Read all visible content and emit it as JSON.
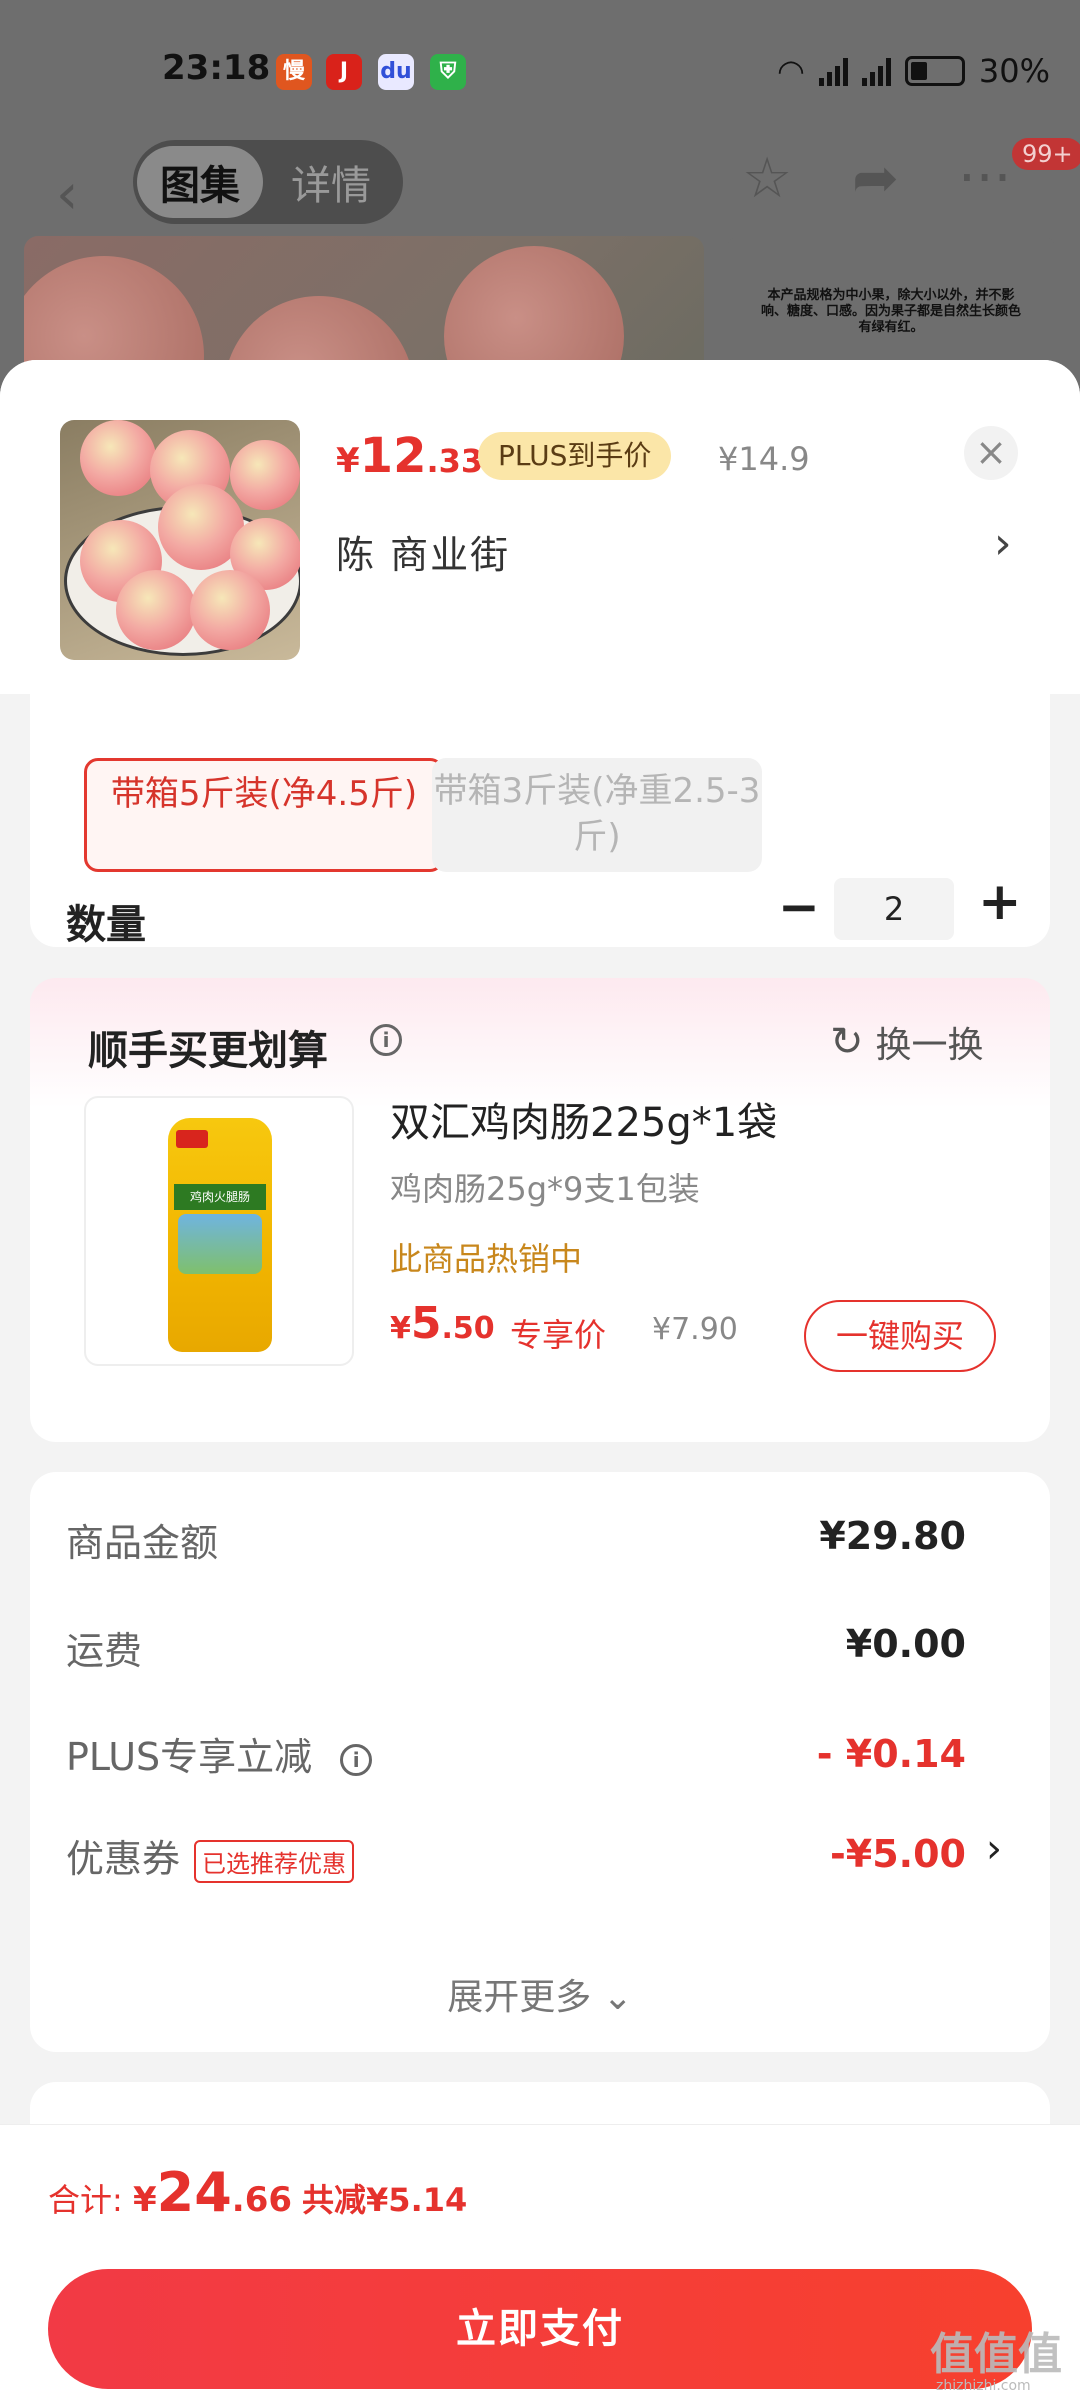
{
  "status_bar": {
    "time": "23:18",
    "app_icons": [
      "douyin-like-icon",
      "jd-app-icon",
      "baidu-icon",
      "security-icon"
    ],
    "network": "5G",
    "battery": "30%"
  },
  "nav": {
    "tab_active": "图集",
    "tab_inactive": "详情",
    "badge": "99+"
  },
  "bg_image_note": "本产品规格为中小果，除大小以外，并不影响、糖度、口感。因为果子都是自然生长颜色有绿有红。",
  "sheet": {
    "price": {
      "currency": "¥",
      "integer": "12",
      "decimal": ".33"
    },
    "plus_tag": "PLUS到手价",
    "original_price": "¥14.9",
    "close": "×",
    "address": "陈  商业街",
    "address_chevron": "›"
  },
  "spec": {
    "options": [
      {
        "label": "带箱5斤装(净4.5斤)",
        "selected": true
      },
      {
        "label": "带箱3斤装(净重2.5-3斤)",
        "selected": false
      }
    ],
    "quantity_label": "数量",
    "quantity": "2",
    "minus": "−",
    "plus": "+"
  },
  "bundle": {
    "title": "顺手买更划算",
    "refresh_label": "换一换",
    "product_name": "双汇鸡肉肠225g*1袋",
    "product_desc": "鸡肉肠25g*9支1包装",
    "product_hot": "此商品热销中",
    "price": {
      "currency": "¥",
      "integer": "5",
      "decimal": ".50"
    },
    "exclusive_label": "专享价",
    "original_price": "¥7.90",
    "buy_button": "一键购买"
  },
  "summary": {
    "rows": [
      {
        "label": "商品金额",
        "value": "¥29.80"
      },
      {
        "label": "运费",
        "value": "¥0.00"
      },
      {
        "label": "PLUS专享立减",
        "value": "- ¥0.14"
      },
      {
        "label": "优惠券",
        "tag": "已选推荐优惠",
        "value": "-¥5.00"
      }
    ],
    "expand_more": "展开更多 ⌄"
  },
  "bottom": {
    "total_label": "合计: ",
    "total": {
      "currency": "¥",
      "integer": "24",
      "decimal": ".66"
    },
    "saved": "共减¥5.14",
    "pay_button": "立即支付"
  },
  "watermark": {
    "text": "值值值",
    "site": "zhizhizhi.com"
  },
  "colors": {
    "accent": "#e5322d",
    "plus_tag_bg": "#fbe6a8",
    "hot_text": "#c8871c"
  }
}
